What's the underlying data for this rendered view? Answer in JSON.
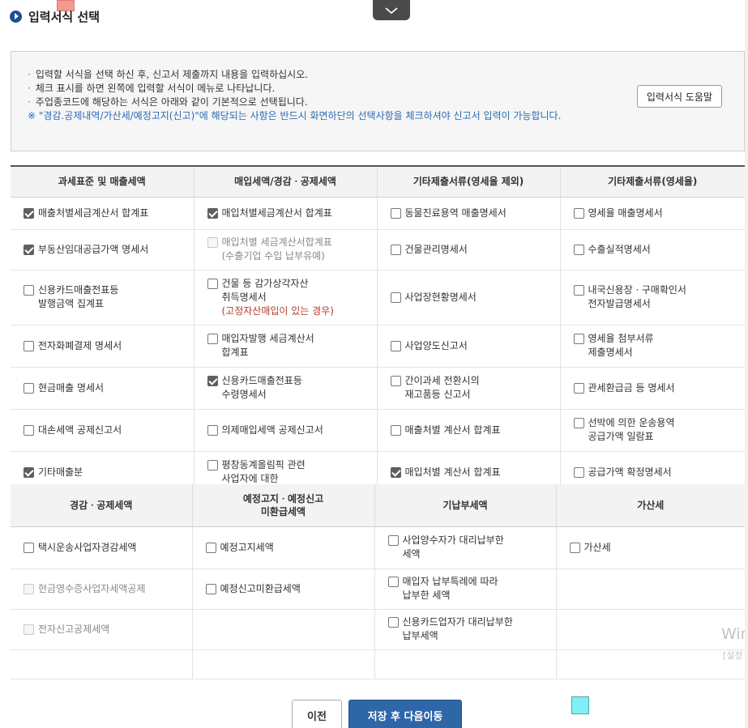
{
  "page": {
    "title": "입력서식 선택",
    "colors": {
      "accent": "#2e66a8",
      "title_icon": "#1d4f91",
      "warn_text": "#2b6ab3",
      "red_note": "#b23b2a"
    }
  },
  "notice": {
    "lines": [
      "입력할 서식을 선택 하신 후, 신고서 제출까지 내용을 입력하십시오.",
      "체크 표시를 하면 왼쪽에 입력할 서식이 메뉴로 나타납니다.",
      "주업종코드에 해당하는 서식은 아래와 같이 기본적으로 선택됩니다."
    ],
    "bullet": "·",
    "warning": "※ \"경감.공제내역/가산세/예정고지(신고)\"에 해당되는 사항은 반드시 화면하단의 선택사항을 체크하셔야 신고서 입력이 가능합니다.",
    "help_button": "입력서식 도움말"
  },
  "table1": {
    "headers": [
      "과세표준 및 매출세액",
      "매입세액/경감ㆍ공제세액",
      "기타제출서류(영세율 제외)",
      "기타제출서류(영세율)"
    ],
    "col0": [
      {
        "lines": [
          "매출처별세금계산서 합계표"
        ],
        "state": "checked"
      },
      {
        "lines": [
          "부동산임대공급가액 명세서"
        ],
        "state": "checked"
      },
      {
        "lines": [
          "신용카드매출전표등",
          "발행금액 집계표"
        ],
        "state": "unchecked"
      },
      {
        "lines": [
          "전자화폐결제 명세서"
        ],
        "state": "unchecked"
      },
      {
        "lines": [
          "현금매출 명세서"
        ],
        "state": "unchecked"
      },
      {
        "lines": [
          "대손세액 공제신고서"
        ],
        "state": "unchecked"
      },
      {
        "lines": [
          "기타매출분"
        ],
        "state": "checked"
      }
    ],
    "col1": [
      {
        "lines": [
          "매입처별세금계산서 합계표"
        ],
        "state": "checked"
      },
      {
        "lines": [
          "매입처별 세금계산서합계표",
          "(수출기업 수입 납부유예)"
        ],
        "state": "disabled"
      },
      {
        "lines": [
          "건물 등 감가상각자산",
          "취득명세서"
        ],
        "note": "(고정자산매입이 있는 경우)",
        "state": "unchecked"
      },
      {
        "lines": [
          "매입자발행 세금계산서",
          "합계표"
        ],
        "state": "unchecked"
      },
      {
        "lines": [
          "신용카드매출전표등",
          "수령명세서"
        ],
        "state": "checked"
      },
      {
        "lines": [
          "의제매입세액 공제신고서"
        ],
        "state": "unchecked"
      },
      {
        "lines": [
          "평창동계올림픽 관련",
          "사업자에 대한"
        ],
        "state": "unchecked"
      }
    ],
    "col2": [
      {
        "lines": [
          "동물진료용역 매출명세서"
        ],
        "state": "unchecked"
      },
      {
        "lines": [
          "건물관리명세서"
        ],
        "state": "unchecked"
      },
      {
        "lines": [
          "사업장현황명세서"
        ],
        "state": "unchecked"
      },
      {
        "lines": [
          "사업양도신고서"
        ],
        "state": "unchecked"
      },
      {
        "lines": [
          "간이과세 전환시의",
          "재고품등 신고서"
        ],
        "state": "unchecked"
      },
      {
        "lines": [
          "매출처별 계산서 합계표"
        ],
        "state": "unchecked"
      },
      {
        "lines": [
          "매입처별 계산서 합계표"
        ],
        "state": "checked"
      }
    ],
    "col3": [
      {
        "lines": [
          "영세율 매출명세서"
        ],
        "state": "unchecked"
      },
      {
        "lines": [
          "수출실적명세서"
        ],
        "state": "unchecked"
      },
      {
        "lines": [
          "내국신용장ㆍ구매확인서",
          "전자발급명세서"
        ],
        "state": "unchecked"
      },
      {
        "lines": [
          "영세율 첨부서류",
          "제출명세서"
        ],
        "state": "unchecked"
      },
      {
        "lines": [
          "관세환급금 등 명세서"
        ],
        "state": "unchecked"
      },
      {
        "lines": [
          "선박에 의한 운송용역",
          "공급가액 일람표"
        ],
        "state": "unchecked"
      },
      {
        "lines": [
          "공급가액 확정명세서"
        ],
        "state": "unchecked"
      }
    ]
  },
  "table2": {
    "headers": [
      "경감ㆍ공제세액",
      "예정고지ㆍ예정신고\n미환급세액",
      "기납부세액",
      "가산세"
    ],
    "col0": [
      {
        "lines": [
          "택시운송사업자경감세액"
        ],
        "state": "unchecked"
      },
      {
        "lines": [
          "현금영수증사업자세액공제"
        ],
        "state": "disabled"
      },
      {
        "lines": [
          "전자신고공제세액"
        ],
        "state": "disabled"
      }
    ],
    "col1": [
      {
        "lines": [
          "예정고지세액"
        ],
        "state": "unchecked"
      },
      {
        "lines": [
          "예정신고미환급세액"
        ],
        "state": "unchecked"
      }
    ],
    "col2": [
      {
        "lines": [
          "사업양수자가 대리납부한",
          "세액"
        ],
        "state": "unchecked"
      },
      {
        "lines": [
          "매입자 납부특례에 따라",
          "납부한 세액"
        ],
        "state": "unchecked"
      },
      {
        "lines": [
          "신용카드업자가 대리납부한",
          "납부세액"
        ],
        "state": "unchecked"
      }
    ],
    "col3": [
      {
        "lines": [
          "가산세"
        ],
        "state": "unchecked"
      }
    ]
  },
  "buttons": {
    "prev": "이전",
    "next": "저장 후 다음이동"
  },
  "watermark": {
    "line1": "Win",
    "line2": "[설정"
  }
}
